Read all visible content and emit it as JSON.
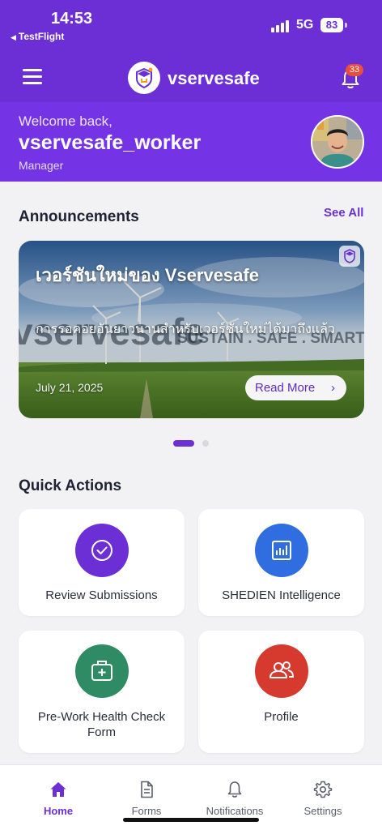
{
  "status_bar": {
    "time": "14:53",
    "back_app": "TestFlight",
    "network": "5G",
    "battery": "83"
  },
  "header": {
    "brand": "vservesafe",
    "notification_count": "33",
    "colors": {
      "primary": "#6c2fd6",
      "badge": "#e94d3c"
    }
  },
  "welcome": {
    "greeting": "Welcome back,",
    "username": "vservesafe_worker",
    "role": "Manager"
  },
  "announcements": {
    "title": "Announcements",
    "see_all": "See All",
    "items": [
      {
        "title": "เวอร์ชันใหม่ของ Vservesafe",
        "subtitle": "การรอคอยอันยาวนานสำหรับเวอร์ชันใหม่ได้มาถึงแล้ว",
        "date": "July 21, 2025",
        "action": "Read More",
        "background_text": "vservesafe",
        "background_tagline": "SUSTAIN . SAFE . SMART"
      }
    ],
    "active_index": 0,
    "total": 2
  },
  "quick_actions": {
    "title": "Quick Actions",
    "items": [
      {
        "label": "Review Submissions",
        "icon": "check-circle-icon",
        "color": "#6c2fd6"
      },
      {
        "label": "SHEDIEN Intelligence",
        "icon": "bar-chart-icon",
        "color": "#2f6de0"
      },
      {
        "label": "Pre-Work Health Check Form",
        "icon": "medical-kit-icon",
        "color": "#2e8b63"
      },
      {
        "label": "Profile",
        "icon": "users-icon",
        "color": "#d63a2f"
      }
    ]
  },
  "bottom_nav": {
    "items": [
      {
        "label": "Home",
        "icon": "home-icon",
        "active": true
      },
      {
        "label": "Forms",
        "icon": "document-icon",
        "active": false
      },
      {
        "label": "Notifications",
        "icon": "bell-icon",
        "active": false
      },
      {
        "label": "Settings",
        "icon": "gear-icon",
        "active": false
      }
    ]
  }
}
